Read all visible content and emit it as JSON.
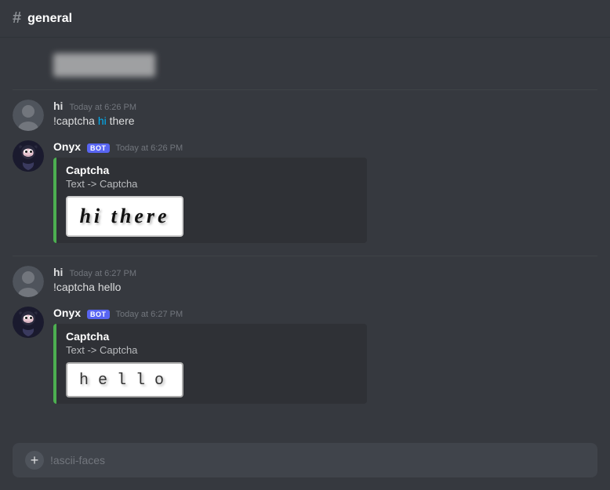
{
  "header": {
    "channel": "general",
    "hash": "#"
  },
  "messages": [
    {
      "id": "msg1",
      "type": "partial",
      "blurred": true
    },
    {
      "id": "msg2",
      "type": "user",
      "username": "hi",
      "timestamp": "Today at 6:26 PM",
      "text": "!captcha hi there",
      "highlight": "hi"
    },
    {
      "id": "msg3",
      "type": "bot",
      "username": "Onyx",
      "bot": true,
      "timestamp": "Today at 6:26 PM",
      "embed": {
        "title": "Captcha",
        "description": "Text -> Captcha",
        "captcha_text": "hi there",
        "captcha_type": "hi"
      }
    },
    {
      "id": "msg4",
      "type": "user",
      "username": "hi",
      "timestamp": "Today at 6:27 PM",
      "text": "!captcha hello",
      "highlight": ""
    },
    {
      "id": "msg5",
      "type": "bot",
      "username": "Onyx",
      "bot": true,
      "timestamp": "Today at 6:27 PM",
      "embed": {
        "title": "Captcha",
        "description": "Text -> Captcha",
        "captcha_text": "hello",
        "captcha_type": "hello"
      }
    }
  ],
  "input": {
    "placeholder": "!ascii-faces",
    "plus_label": "+"
  },
  "labels": {
    "bot_badge": "BOT",
    "captcha_title": "Captcha",
    "captcha_desc": "Text -> Captcha"
  }
}
